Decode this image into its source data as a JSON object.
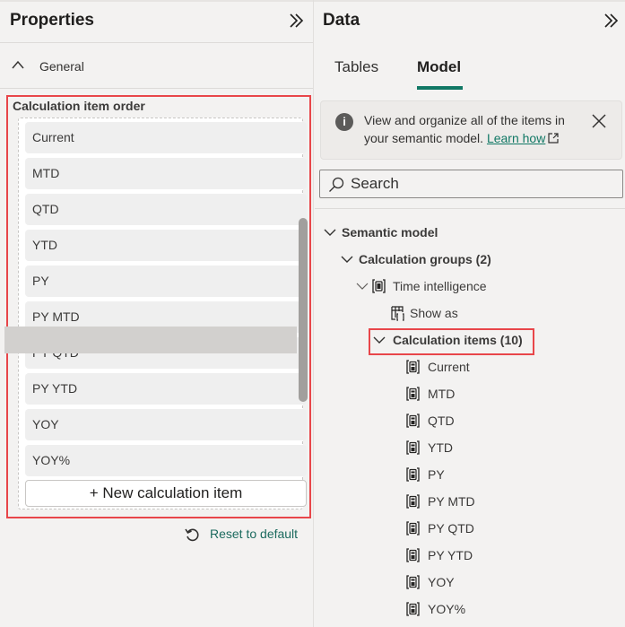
{
  "properties_panel": {
    "title": "Properties",
    "collapse_icon": "double-chevron-right-icon",
    "general_section": {
      "label": "General",
      "expanded": true
    },
    "calculation_item_order": {
      "title": "Calculation item order",
      "items": [
        "Current",
        "MTD",
        "QTD",
        "YTD",
        "PY",
        "PY MTD",
        "PY QTD",
        "PY YTD",
        "YOY",
        "YOY%"
      ],
      "new_item_button": "+ New calculation item"
    },
    "reset_button": "Reset to default"
  },
  "data_panel": {
    "title": "Data",
    "collapse_icon": "double-chevron-right-icon",
    "tabs": [
      {
        "label": "Tables",
        "active": false
      },
      {
        "label": "Model",
        "active": true
      }
    ],
    "info_bar": {
      "text": "View and organize all of the items in your semantic model.",
      "link": "Learn how",
      "info_icon_glyph": "i"
    },
    "search": {
      "placeholder": "Search",
      "value": ""
    },
    "tree": {
      "root": "Semantic model",
      "calc_groups": "Calculation groups (2)",
      "group": "Time intelligence",
      "show_as": "Show as",
      "calc_items_folder": "Calculation items (10)",
      "calc_items": [
        "Current",
        "MTD",
        "QTD",
        "YTD",
        "PY",
        "PY MTD",
        "PY QTD",
        "PY YTD",
        "YOY",
        "YOY%"
      ]
    }
  },
  "colors": {
    "accent": "#117865",
    "highlight_border": "#e8464a",
    "background": "#f3f2f1",
    "selected_row": "#d2d0ce"
  }
}
